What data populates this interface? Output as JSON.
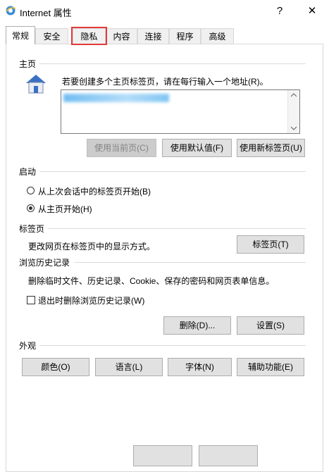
{
  "window": {
    "title": "Internet 属性",
    "help": "?",
    "close": "✕"
  },
  "tabs": [
    {
      "label": "常规"
    },
    {
      "label": "安全"
    },
    {
      "label": "隐私"
    },
    {
      "label": "内容"
    },
    {
      "label": "连接"
    },
    {
      "label": "程序"
    },
    {
      "label": "高级"
    }
  ],
  "home": {
    "section": "主页",
    "instruction": "若要创建多个主页标签页，请在每行输入一个地址(R)。",
    "btn_current": "使用当前页(C)",
    "btn_default": "使用默认值(F)",
    "btn_newtab": "使用新标签页(U)"
  },
  "startup": {
    "section": "启动",
    "option1": "从上次会话中的标签页开始(B)",
    "option2": "从主页开始(H)",
    "selected": "option2"
  },
  "tabsec": {
    "section": "标签页",
    "desc": "更改网页在标签页中的显示方式。",
    "btn": "标签页(T)"
  },
  "history": {
    "section": "浏览历史记录",
    "desc": "删除临时文件、历史记录、Cookie、保存的密码和网页表单信息。",
    "checkbox": "退出时删除浏览历史记录(W)",
    "btn_delete": "删除(D)...",
    "btn_settings": "设置(S)"
  },
  "appearance": {
    "section": "外观",
    "btn_colors": "颜色(O)",
    "btn_lang": "语言(L)",
    "btn_fonts": "字体(N)",
    "btn_access": "辅助功能(E)"
  }
}
